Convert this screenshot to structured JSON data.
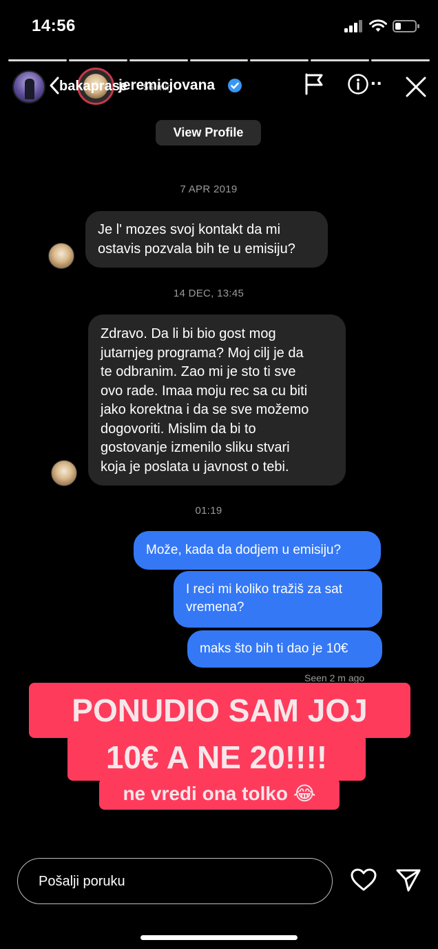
{
  "status_bar": {
    "time": "14:56"
  },
  "story": {
    "username": "bakaprase",
    "age": "56 min"
  },
  "dm_header": {
    "username": "jeremicjovana"
  },
  "view_profile_label": "View Profile",
  "timestamps": [
    "7 APR 2019",
    "14 DEC, 13:45",
    "01:19"
  ],
  "incoming_messages": [
    {
      "lines": [
        "Je l' mozes svoj kontakt da mi",
        "ostavis pozvala bih te u emisiju?"
      ]
    },
    {
      "lines": [
        "Zdravo. Da li bi bio gost mog",
        "jutarnjeg programa? Moj cilj je da",
        "te odbranim. Zao mi je sto ti sve",
        "ovo rade.  Imaa moju rec sa cu biti",
        "jako korektna i da se sve možemo",
        "dogovoriti. Mislim da bi to",
        "gostovanje izmenilo sliku stvari",
        "koja je poslata u javnost o tebi."
      ]
    }
  ],
  "outgoing_messages": [
    {
      "lines": [
        "Može, kada da dodjem u emisiju?"
      ]
    },
    {
      "lines": [
        "I reci mi koliko tražiš za sat",
        "vremena?"
      ]
    },
    {
      "lines": [
        "maks što bih ti dao je 10€"
      ]
    }
  ],
  "seen_label": "Seen 2 m ago",
  "caption": {
    "line1": "PONUDIO SAM JOJ",
    "line2": "10€ A NE 20!!!!",
    "line3": "ne vredi ona tolko 😂",
    "color": "#ff3b5c"
  },
  "reply": {
    "placeholder": "Pošalji poruku"
  },
  "icons": [
    "signal-icon",
    "wifi-icon",
    "battery-icon",
    "back-chevron-icon",
    "verified-badge-icon",
    "flag-icon",
    "info-icon",
    "close-icon",
    "heart-icon",
    "send-icon"
  ],
  "colors": {
    "outgoing_bubble": "#3478f6",
    "incoming_bubble": "#262626",
    "background": "#000000"
  }
}
